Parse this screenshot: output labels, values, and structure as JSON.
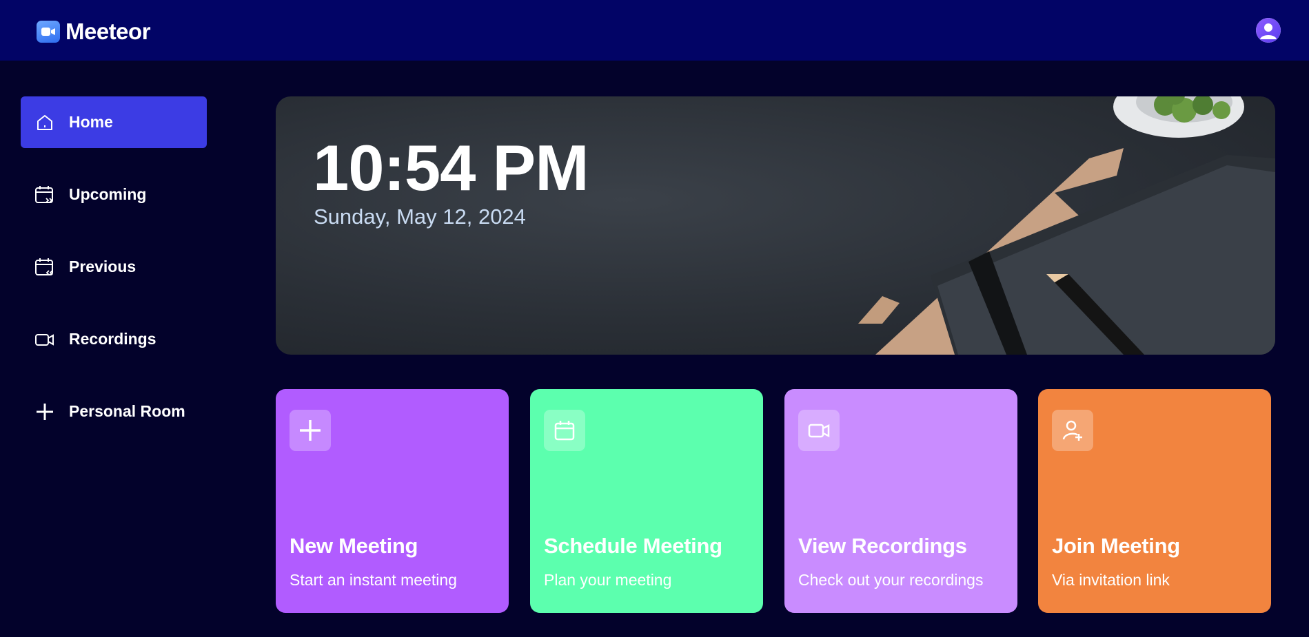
{
  "app": {
    "name": "Meeteor"
  },
  "colors": {
    "topbar": "#020466",
    "background": "#03022b",
    "active_nav": "#3c3ce4",
    "card_new": "#b15cff",
    "card_schedule": "#5cffae",
    "card_recordings": "#c98cff",
    "card_join": "#f2843f"
  },
  "sidebar": {
    "items": [
      {
        "label": "Home",
        "icon": "home-icon",
        "active": true
      },
      {
        "label": "Upcoming",
        "icon": "calendar-upcoming-icon",
        "active": false
      },
      {
        "label": "Previous",
        "icon": "calendar-previous-icon",
        "active": false
      },
      {
        "label": "Recordings",
        "icon": "video-icon",
        "active": false
      },
      {
        "label": "Personal Room",
        "icon": "plus-icon",
        "active": false
      }
    ]
  },
  "hero": {
    "time": "10:54 PM",
    "date": "Sunday, May 12, 2024"
  },
  "cards": [
    {
      "title": "New Meeting",
      "subtitle": "Start an instant meeting",
      "icon": "plus-icon"
    },
    {
      "title": "Schedule Meeting",
      "subtitle": "Plan your meeting",
      "icon": "calendar-icon"
    },
    {
      "title": "View Recordings",
      "subtitle": "Check out your recordings",
      "icon": "video-icon"
    },
    {
      "title": "Join Meeting",
      "subtitle": "Via invitation link",
      "icon": "add-user-icon"
    }
  ]
}
